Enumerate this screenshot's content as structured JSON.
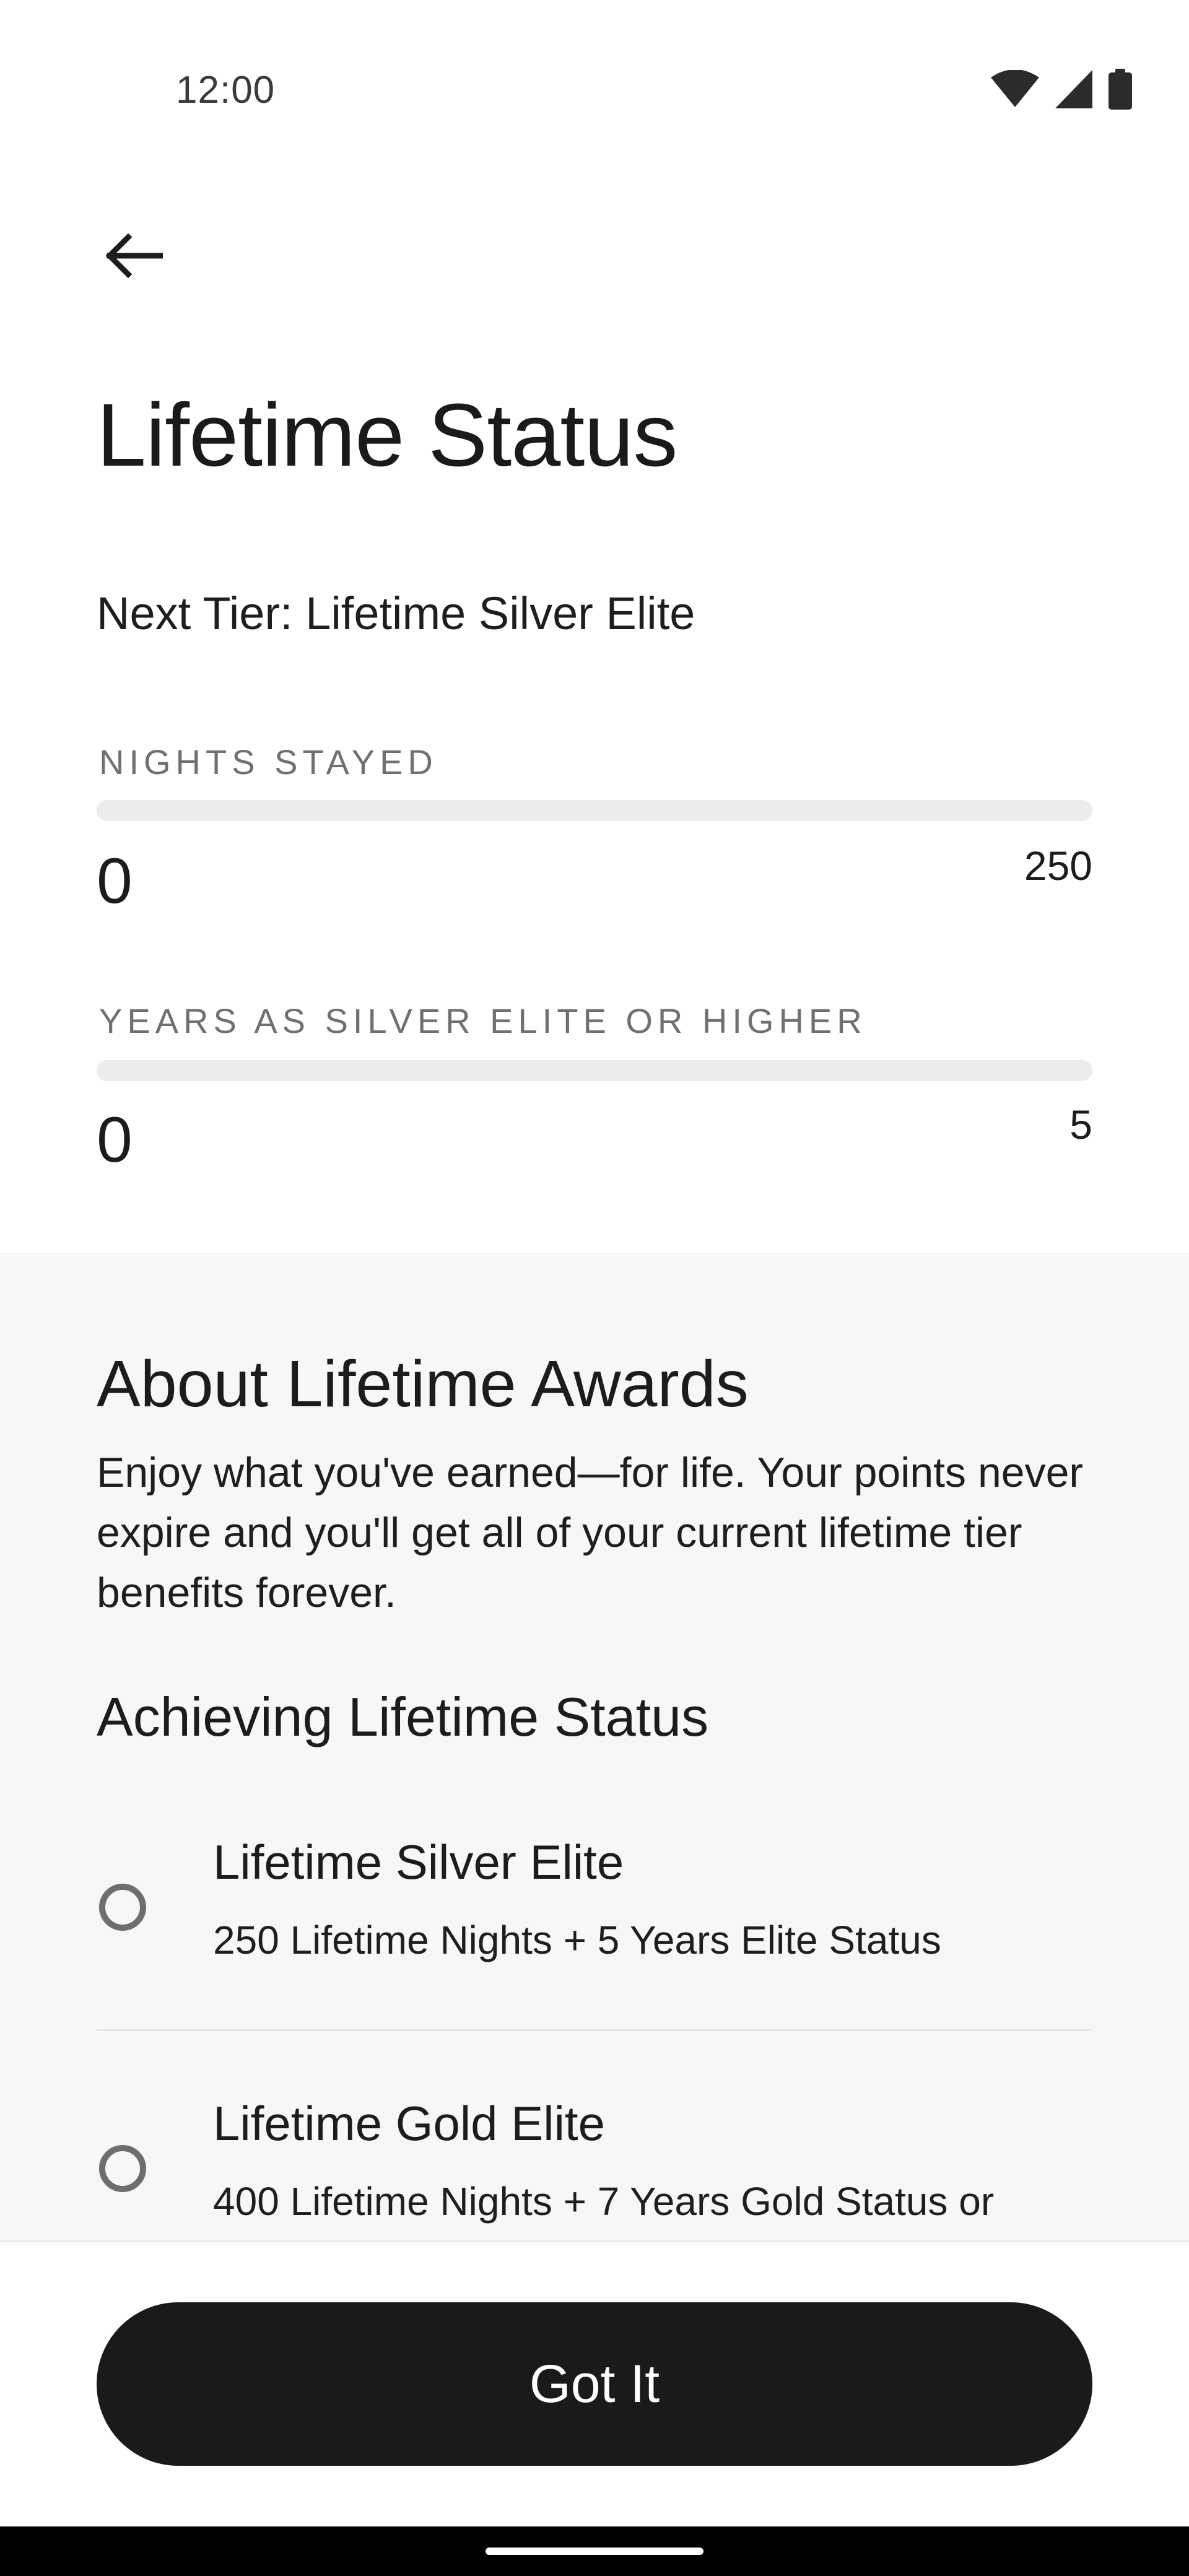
{
  "status_bar": {
    "time": "12:00",
    "icons": [
      "wifi-icon",
      "cellular-signal-icon",
      "battery-icon"
    ]
  },
  "header": {
    "back_icon": "arrow-left-icon",
    "title": "Lifetime Status"
  },
  "next_tier": "Next Tier: Lifetime Silver Elite",
  "metrics": [
    {
      "label": "NIGHTS STAYED",
      "value": "0",
      "max": "250",
      "progress": 0
    },
    {
      "label": "YEARS AS SILVER ELITE OR HIGHER",
      "value": "0",
      "max": "5",
      "progress": 0
    }
  ],
  "about": {
    "title": "About Lifetime Awards",
    "body": "Enjoy what you've earned—for life. Your points never expire and you'll get all of your current lifetime tier benefits forever.",
    "achieving_title": "Achieving Lifetime Status",
    "tiers": [
      {
        "name": "Lifetime Silver Elite",
        "requirement": "250 Lifetime Nights + 5 Years Elite Status",
        "achieved": false
      },
      {
        "name": "Lifetime Gold Elite",
        "requirement": "400 Lifetime Nights + 7 Years Gold Status or",
        "achieved": false
      }
    ]
  },
  "footer": {
    "button_label": "Got It"
  },
  "colors": {
    "primary": "#1a1a1a",
    "track": "#ececec",
    "section_bg": "#f7f7f7",
    "muted_text": "#707070"
  }
}
